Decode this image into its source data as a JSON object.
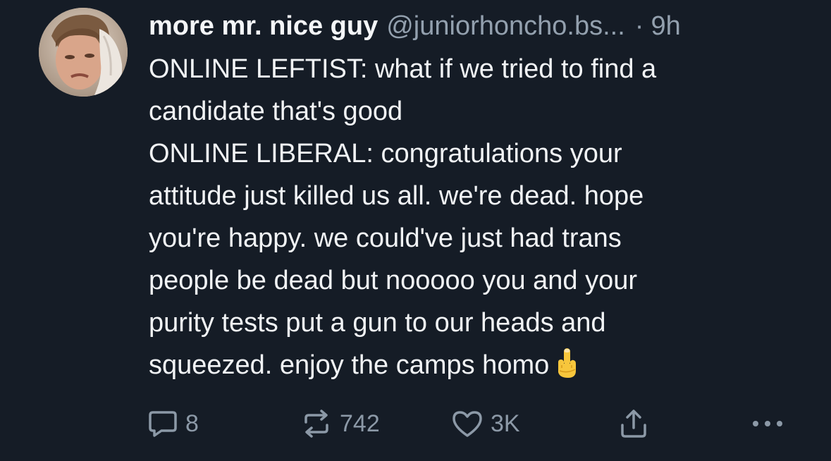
{
  "post": {
    "display_name": "more mr. nice guy",
    "handle": "@juniorhoncho.bs...",
    "separator": "·",
    "time": "9h",
    "text": "ONLINE LEFTIST: what if we tried to find a\ncandidate that's good\nONLINE LIBERAL: congratulations your\nattitude just killed us all. we're dead. hope\nyou're happy. we could've just had trans\npeople be dead but nooooo you and your\npurity tests put a gun to our heads and\nsqueezed. enjoy the camps homo",
    "emoji": "middle-finger-emoji"
  },
  "actions": {
    "reply_count": "8",
    "repost_count": "742",
    "like_count": "3K"
  },
  "icons": {
    "reply": "speech-bubble-icon",
    "repost": "repost-arrows-icon",
    "like": "heart-icon",
    "share": "share-upload-icon",
    "more": "more-dots-icon"
  },
  "colors": {
    "background": "#151c26",
    "text": "#f1f3f5",
    "muted": "#93a0ae",
    "icon": "#8c99a7"
  }
}
